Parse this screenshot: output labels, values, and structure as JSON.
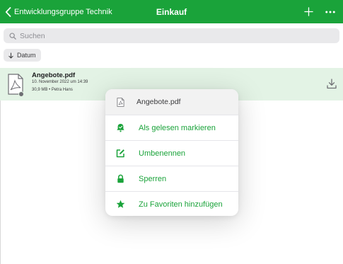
{
  "header": {
    "back_label": "Entwicklungsgruppe Technik",
    "title": "Einkauf",
    "accent_color": "#1aa33a"
  },
  "search": {
    "placeholder": "Suchen",
    "value": ""
  },
  "sort": {
    "label": "Datum"
  },
  "file": {
    "name": "Angebote.pdf",
    "date": "10. November 2022 um 14:39",
    "size": "30,9 MB",
    "separator": "•",
    "author": "Petra Hans"
  },
  "context_menu": {
    "header": "Angebote.pdf",
    "items": [
      {
        "label": "Als gelesen markieren",
        "icon": "read-marker-icon"
      },
      {
        "label": "Umbenennen",
        "icon": "edit-icon"
      },
      {
        "label": "Sperren",
        "icon": "lock-icon"
      },
      {
        "label": "Zu Favoriten hinzufügen",
        "icon": "star-icon"
      }
    ]
  }
}
